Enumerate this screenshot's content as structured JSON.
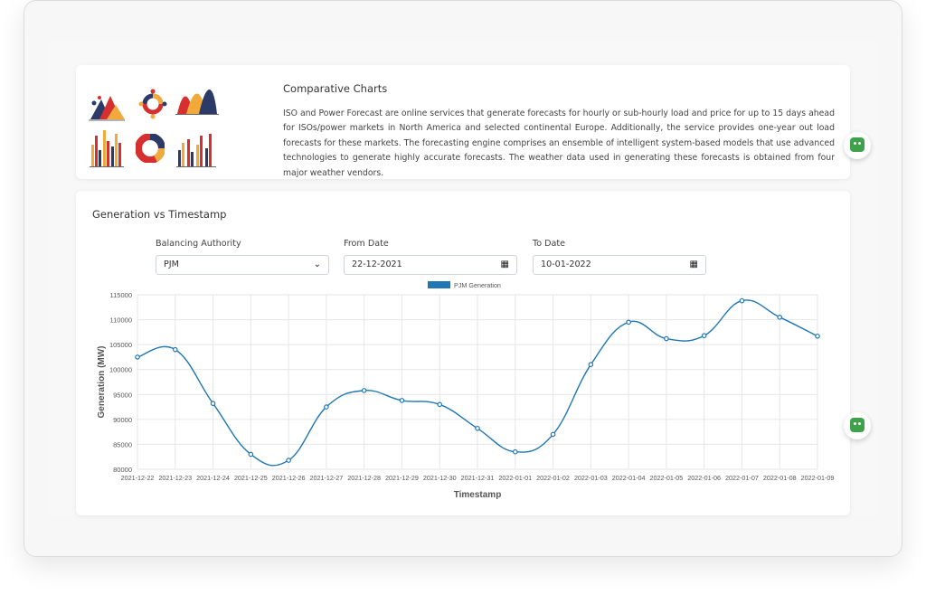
{
  "intro": {
    "title": "Comparative Charts",
    "description": "ISO and Power Forecast are online services that generate forecasts for hourly or sub-hourly load and price for up to 15 days ahead for ISOs/power markets in North America and selected continental Europe. Additionally, the service provides one-year out load forecasts for these markets. The forecasting engine comprises an ensemble of intelligent system-based models that use advanced technologies to generate highly accurate forecasts. The weather data used in generating these forecasts is obtained from four major weather vendors."
  },
  "panel": {
    "title": "Generation vs Timestamp",
    "balancing_authority": {
      "label": "Balancing Authority",
      "value": "PJM"
    },
    "from_date": {
      "label": "From Date",
      "value": "22-12-2021"
    },
    "to_date": {
      "label": "To Date",
      "value": "10-01-2022"
    }
  },
  "chart_data": {
    "type": "line",
    "x": [
      "2021-12-22",
      "2021-12-23",
      "2021-12-24",
      "2021-12-25",
      "2021-12-26",
      "2021-12-27",
      "2021-12-28",
      "2021-12-29",
      "2021-12-30",
      "2021-12-31",
      "2022-01-01",
      "2022-01-02",
      "2022-01-03",
      "2022-01-04",
      "2022-01-05",
      "2022-01-06",
      "2022-01-07",
      "2022-01-08",
      "2022-01-09"
    ],
    "series": [
      {
        "name": "PJM Generation",
        "color": "#1f77b4",
        "values": [
          102500,
          104000,
          93200,
          83000,
          81800,
          92500,
          95800,
          93800,
          93000,
          88200,
          83500,
          87000,
          101000,
          109500,
          106200,
          106800,
          113800,
          110500,
          106700
        ]
      }
    ],
    "xlabel": "Timestamp",
    "ylabel": "Generation (MW)",
    "ylim": [
      80000,
      115000
    ],
    "yticks": [
      80000,
      85000,
      90000,
      95000,
      100000,
      105000,
      110000,
      115000
    ],
    "grid": true,
    "legend": "top-center"
  }
}
